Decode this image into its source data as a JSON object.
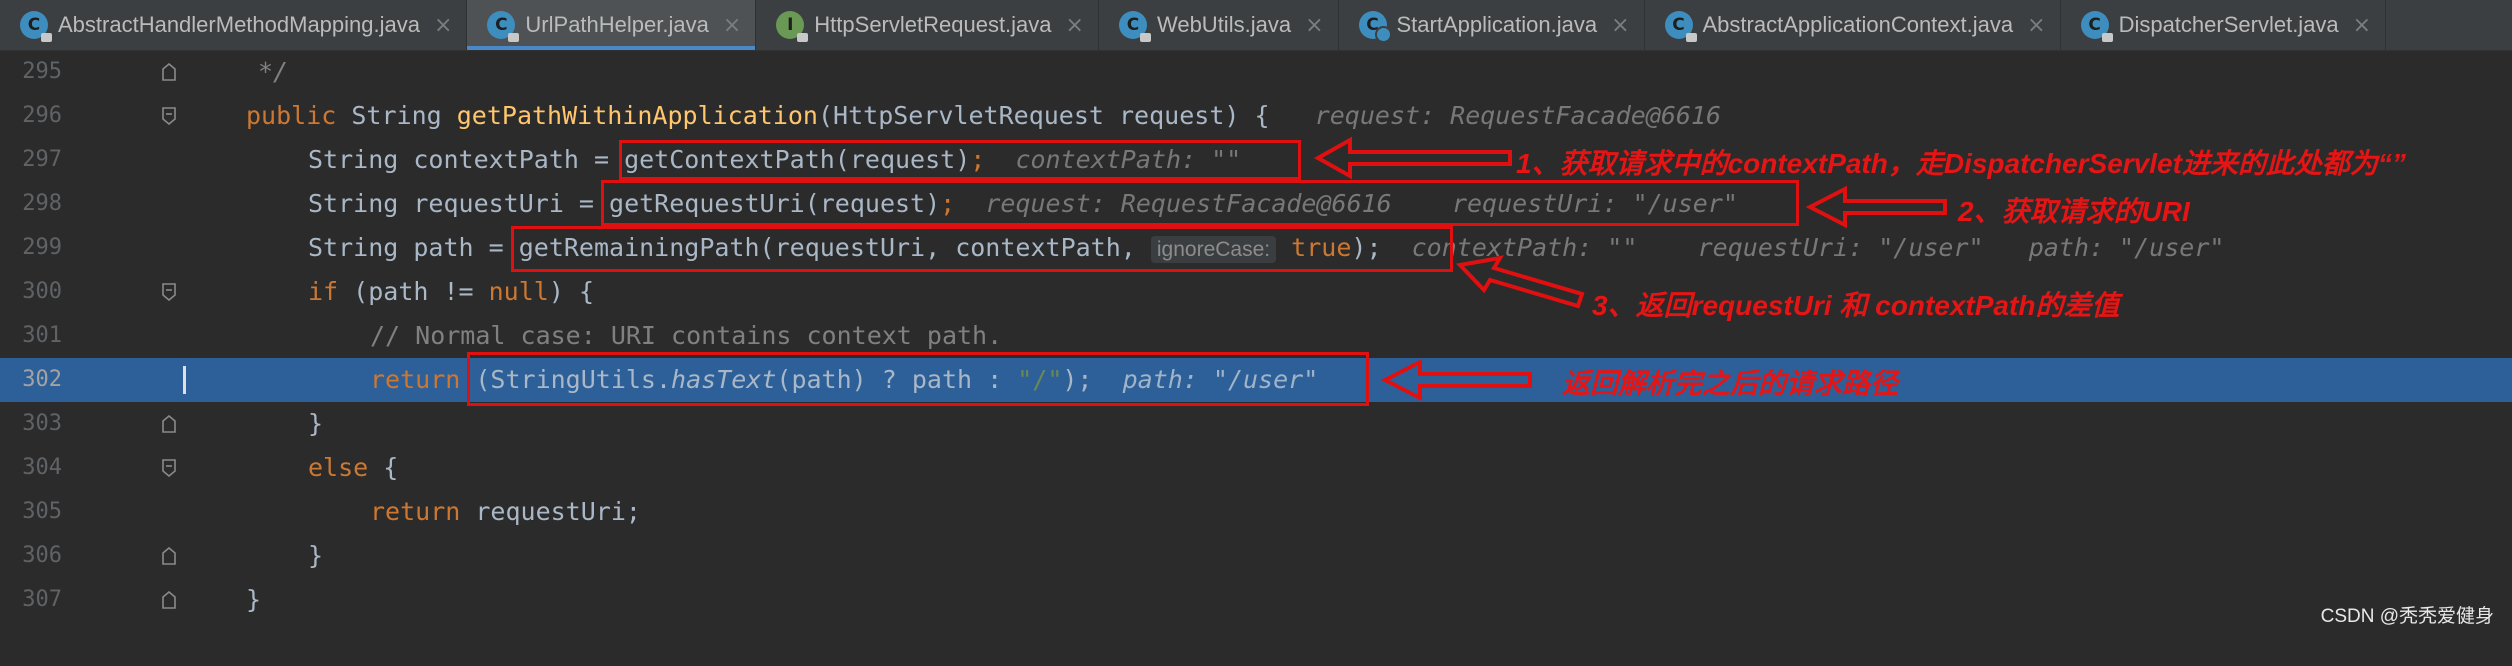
{
  "tabs": [
    {
      "label": "AbstractHandlerMethodMapping.java",
      "icon": "java-class-icon",
      "active": false
    },
    {
      "label": "UrlPathHelper.java",
      "icon": "java-class-icon",
      "active": true
    },
    {
      "label": "HttpServletRequest.java",
      "icon": "java-interface-icon",
      "active": false
    },
    {
      "label": "WebUtils.java",
      "icon": "java-class-icon",
      "active": false
    },
    {
      "label": "StartApplication.java",
      "icon": "java-run-class-icon",
      "active": false
    },
    {
      "label": "AbstractApplicationContext.java",
      "icon": "java-class-icon",
      "active": false
    },
    {
      "label": "DispatcherServlet.java",
      "icon": "java-class-icon",
      "active": false
    }
  ],
  "editor": {
    "current_line": 302,
    "lines": [
      {
        "no": "295",
        "tokens": {
          "c1": "*/"
        }
      },
      {
        "no": "296",
        "tokens": {
          "kw": "public",
          "type": "String",
          "method": "getPathWithinApplication",
          "params": "(HttpServletRequest request) {",
          "hint": "request: RequestFacade@6616"
        }
      },
      {
        "no": "297",
        "tokens": {
          "lhs": "String contextPath = ",
          "call": "getContextPath(request)",
          "semi": ";",
          "hint": "contextPath: \"\""
        }
      },
      {
        "no": "298",
        "tokens": {
          "lhs": "String requestUri = ",
          "call": "getRequestUri(request)",
          "semi": ";",
          "hint1": "request: RequestFacade@6616",
          "hint2": "requestUri: \"/user\""
        }
      },
      {
        "no": "299",
        "tokens": {
          "lhs": "String path = ",
          "call": "getRemainingPath(requestUri, contextPath, ",
          "param_hint": "ignoreCase:",
          "kwval": "true",
          "tail": ");",
          "hint1": "contextPath: \"\"",
          "hint2": "requestUri: \"/user\"",
          "hint3": "path: \"/user\""
        }
      },
      {
        "no": "300",
        "tokens": {
          "kw": "if",
          "open": " (path != ",
          "nul": "null",
          "close": ") {"
        }
      },
      {
        "no": "301",
        "tokens": {
          "comment": "// Normal case: URI contains context path."
        }
      },
      {
        "no": "302",
        "tokens": {
          "kw": "return",
          "pre": " (StringUtils.",
          "itm": "hasText",
          "mid": "(path) ? path : ",
          "str": "\"/\"",
          "end": ");",
          "hint": "path: \"/user\""
        }
      },
      {
        "no": "303",
        "tokens": {
          "close": "}"
        }
      },
      {
        "no": "304",
        "tokens": {
          "kw": "else",
          "open": " {"
        }
      },
      {
        "no": "305",
        "tokens": {
          "kw": "return",
          "rest": " requestUri;"
        }
      },
      {
        "no": "306",
        "tokens": {
          "close": "}"
        }
      },
      {
        "no": "307",
        "tokens": {
          "close": "}"
        }
      }
    ]
  },
  "annotations": {
    "note1": "1、获取请求中的contextPath，走DispatcherServlet进来的此处都为“”",
    "note2": "2、获取请求的URI",
    "note3": "3、返回requestUri 和 contextPath的差值",
    "note4": "返回解析完之后的请求路径",
    "color": "#e01010"
  },
  "watermark": "CSDN @秃秃爱健身",
  "colors": {
    "keyword": "#cc7832",
    "method": "#ffc66d",
    "string": "#6a8759",
    "current_line": "#2d6099",
    "background": "#2b2b2b"
  }
}
